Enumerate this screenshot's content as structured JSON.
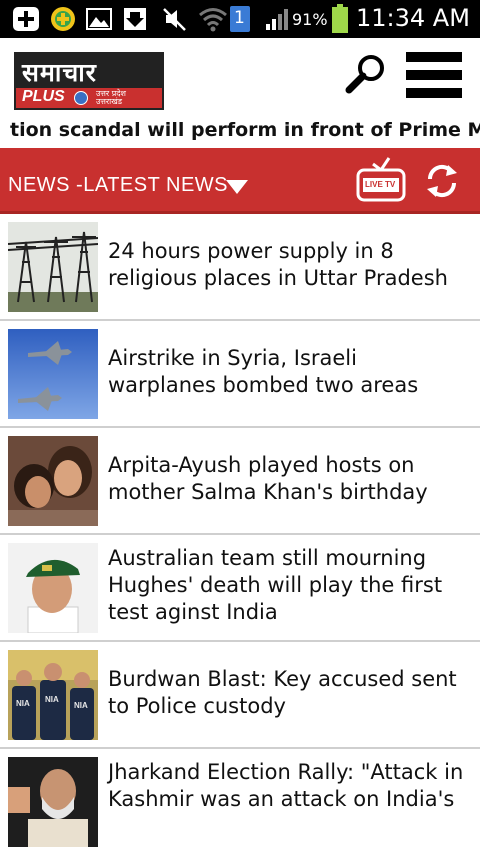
{
  "status_bar": {
    "battery_percent": "91%",
    "time": "11:34 AM",
    "sim_badge": "1",
    "icons": [
      "add-icon",
      "plus-badge-icon",
      "gallery-icon",
      "download-icon",
      "mute-icon",
      "wifi-icon",
      "signal-icon",
      "battery-icon"
    ]
  },
  "header": {
    "logo_main": "समाचार",
    "logo_plus": "PLUS",
    "logo_sub_line1": "उत्तर प्रदेश",
    "logo_sub_line2": "उत्तराखंड",
    "search_icon": "search-icon",
    "menu_icon": "hamburger-menu-icon"
  },
  "ticker": {
    "text": "tion scandal will perform in front of Prime Minister's H"
  },
  "category_bar": {
    "label": "NEWS -LATEST NEWS",
    "live_tv_label": "LIVE",
    "tv_label": "TV",
    "colors": {
      "bar": "#c8302f",
      "text": "#ffffff"
    }
  },
  "news": [
    {
      "headline": "24 hours power supply in 8 religious places in Uttar Pradesh",
      "thumb": "power-towers-thumbnail"
    },
    {
      "headline": "Airstrike in Syria, Israeli warplanes bombed two areas",
      "thumb": "fighter-jets-thumbnail"
    },
    {
      "headline": "Arpita-Ayush played hosts on mother Salma Khan's birthday",
      "thumb": "couple-photo-thumbnail"
    },
    {
      "headline": "Australian team still mourning Hughes' death will play the first test aginst India",
      "thumb": "cricketer-thumbnail"
    },
    {
      "headline": "Burdwan Blast: Key accused sent to Police custody",
      "thumb": "nia-officers-thumbnail"
    },
    {
      "headline": "Jharkand Election Rally: \"Attack in Kashmir was an attack on India's",
      "thumb": "politician-thumbnail"
    }
  ]
}
